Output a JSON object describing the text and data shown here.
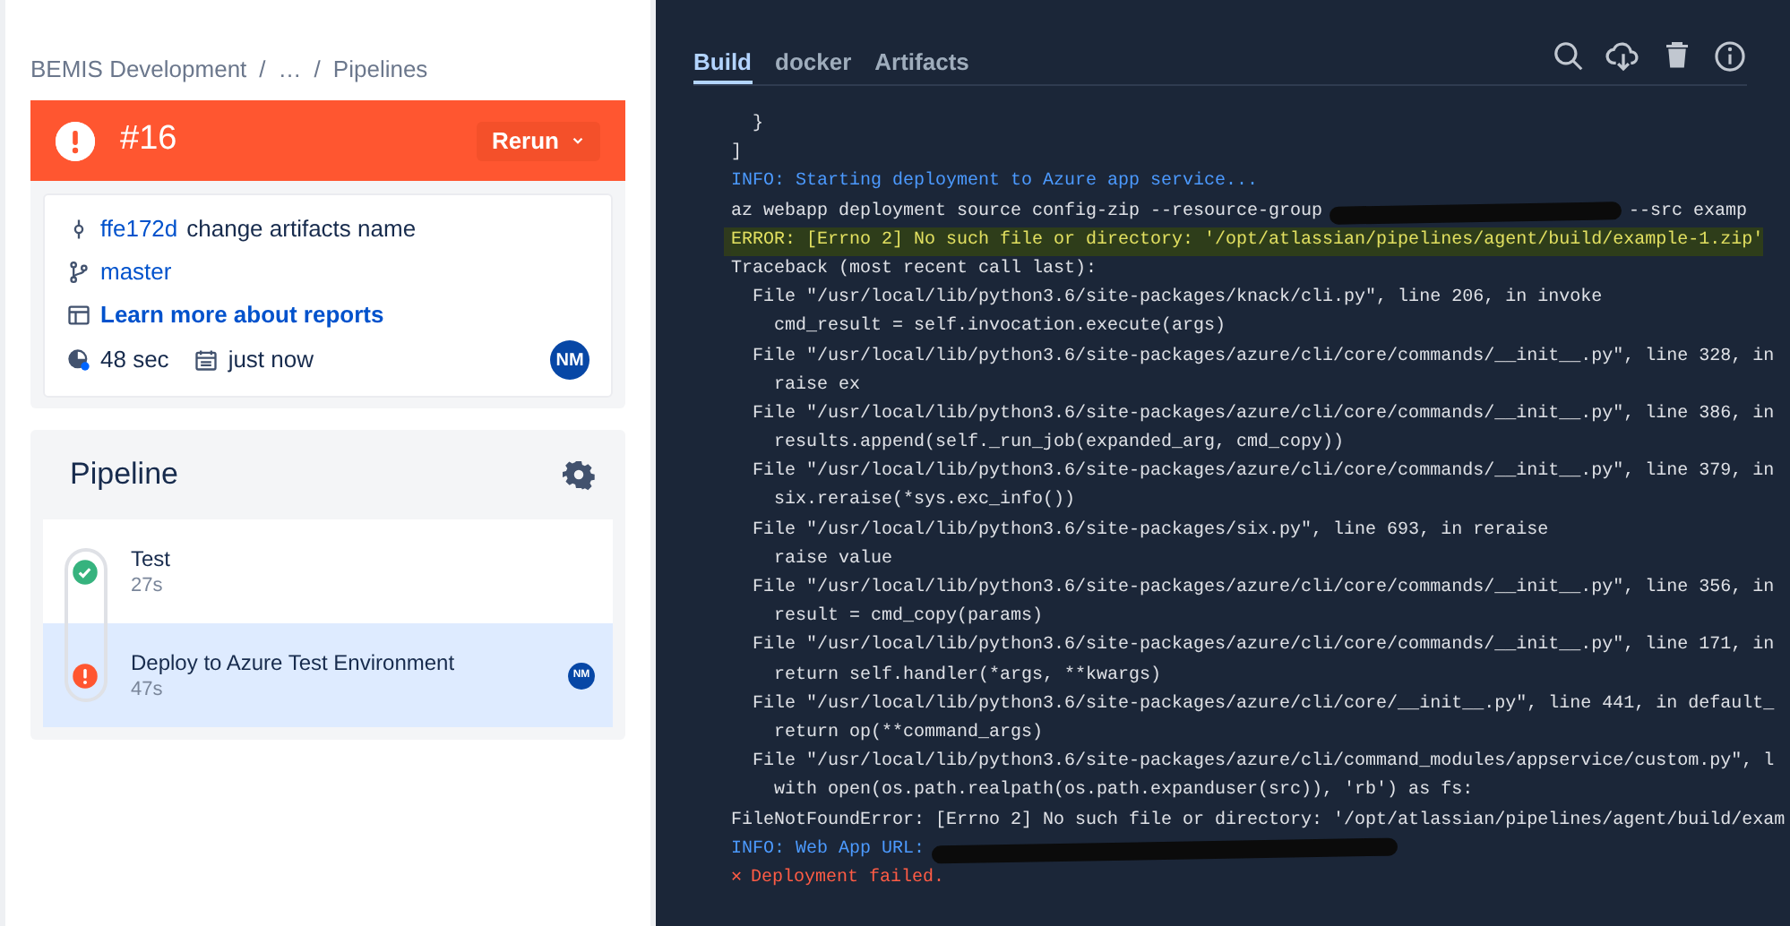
{
  "breadcrumb": {
    "separator": "/",
    "items": [
      "BEMIS Development",
      "…",
      "Pipelines"
    ]
  },
  "build": {
    "kind": "failed",
    "number": "#16",
    "rerun": "Rerun"
  },
  "commit": {
    "hash": "ffe172d",
    "message": "change artifacts name"
  },
  "branch": "master",
  "reports_link": "Learn more about reports",
  "duration": "48 sec",
  "time": "just now",
  "avatar": "NM",
  "pipeline": {
    "title": "Pipeline",
    "steps": [
      {
        "name": "Test",
        "duration": "27s",
        "kind": "passed",
        "selected": false
      },
      {
        "name": "Deploy to Azure Test Environment",
        "duration": "47s",
        "kind": "failed",
        "selected": true,
        "avatar": "NM"
      }
    ]
  },
  "tabs": [
    {
      "label": "Build",
      "selected": true
    },
    {
      "label": "docker",
      "selected": false
    },
    {
      "label": "Artifacts",
      "selected": false
    }
  ],
  "log": [
    {
      "kind": "plain",
      "text": "  }"
    },
    {
      "kind": "plain",
      "text": "]"
    },
    {
      "kind": "info",
      "text": "INFO: Starting deployment to Azure app service..."
    },
    {
      "kind": "plain",
      "text": "az webapp deployment source config-zip --resource-group",
      "redacted": true,
      "tail": "--src examp"
    },
    {
      "kind": "error",
      "text": "ERROR: [Errno 2] No such file or directory: '/opt/atlassian/pipelines/agent/build/example-1.zip'"
    },
    {
      "kind": "plain",
      "text": "Traceback (most recent call last):"
    },
    {
      "kind": "plain",
      "text": "  File \"/usr/local/lib/python3.6/site-packages/knack/cli.py\", line 206, in invoke"
    },
    {
      "kind": "plain",
      "text": "    cmd_result = self.invocation.execute(args)"
    },
    {
      "kind": "plain",
      "text": "  File \"/usr/local/lib/python3.6/site-packages/azure/cli/core/commands/__init__.py\", line 328, in"
    },
    {
      "kind": "plain",
      "text": "    raise ex"
    },
    {
      "kind": "plain",
      "text": "  File \"/usr/local/lib/python3.6/site-packages/azure/cli/core/commands/__init__.py\", line 386, in"
    },
    {
      "kind": "plain",
      "text": "    results.append(self._run_job(expanded_arg, cmd_copy))"
    },
    {
      "kind": "plain",
      "text": "  File \"/usr/local/lib/python3.6/site-packages/azure/cli/core/commands/__init__.py\", line 379, in"
    },
    {
      "kind": "plain",
      "text": "    six.reraise(*sys.exc_info())"
    },
    {
      "kind": "plain",
      "text": "  File \"/usr/local/lib/python3.6/site-packages/six.py\", line 693, in reraise"
    },
    {
      "kind": "plain",
      "text": "    raise value"
    },
    {
      "kind": "plain",
      "text": "  File \"/usr/local/lib/python3.6/site-packages/azure/cli/core/commands/__init__.py\", line 356, in"
    },
    {
      "kind": "plain",
      "text": "    result = cmd_copy(params)"
    },
    {
      "kind": "plain",
      "text": "  File \"/usr/local/lib/python3.6/site-packages/azure/cli/core/commands/__init__.py\", line 171, in"
    },
    {
      "kind": "plain",
      "text": "    return self.handler(*args, **kwargs)"
    },
    {
      "kind": "plain",
      "text": "  File \"/usr/local/lib/python3.6/site-packages/azure/cli/core/__init__.py\", line 441, in default_"
    },
    {
      "kind": "plain",
      "text": "    return op(**command_args)"
    },
    {
      "kind": "plain",
      "text": "  File \"/usr/local/lib/python3.6/site-packages/azure/cli/command_modules/appservice/custom.py\", l"
    },
    {
      "kind": "plain",
      "text": "    with open(os.path.realpath(os.path.expanduser(src)), 'rb') as fs:"
    },
    {
      "kind": "plain",
      "text": "FileNotFoundError: [Errno 2] No such file or directory: '/opt/atlassian/pipelines/agent/build/exam"
    },
    {
      "kind": "info",
      "text": "INFO: Web App URL:",
      "redacted": true
    },
    {
      "kind": "failed",
      "icon": "✕",
      "text": "Deployment failed."
    }
  ]
}
